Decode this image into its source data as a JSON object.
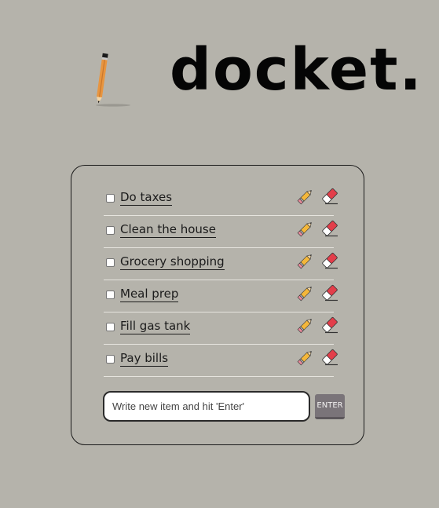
{
  "header": {
    "logo_text": "docket."
  },
  "todos": [
    {
      "label": "Do taxes",
      "checked": false
    },
    {
      "label": "Clean the house",
      "checked": false
    },
    {
      "label": "Grocery shopping",
      "checked": false
    },
    {
      "label": "Meal prep",
      "checked": false
    },
    {
      "label": "Fill gas tank",
      "checked": false
    },
    {
      "label": "Pay bills",
      "checked": false
    }
  ],
  "todo_actions": {
    "edit_icon": "pencil-icon",
    "delete_icon": "eraser-icon"
  },
  "new_item": {
    "placeholder": "Write new item and hit 'Enter'",
    "value": "",
    "button_label": "ENTER"
  },
  "colors": {
    "background": "#b5b3ab",
    "pencil_body": "#e8953f",
    "eraser_red": "#e33e4a",
    "enter_button": "#7a7479"
  }
}
